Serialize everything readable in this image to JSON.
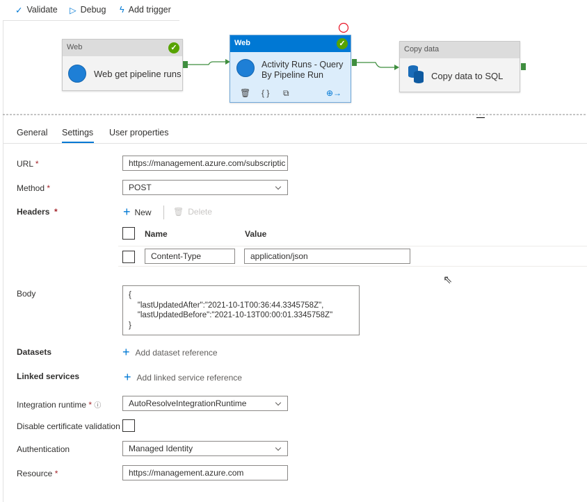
{
  "toolbar": {
    "validate": "Validate",
    "debug": "Debug",
    "add_trigger": "Add trigger"
  },
  "canvas": {
    "nodes": [
      {
        "type": "Web",
        "name": "Web get pipeline runs",
        "status": "succeeded"
      },
      {
        "type": "Web",
        "name_line1": "Activity Runs - Query",
        "name_line2": "By Pipeline Run",
        "status": "succeeded",
        "selected": true
      },
      {
        "type": "Copy data",
        "name": "Copy data to SQL"
      }
    ]
  },
  "tabs": [
    {
      "label": "General"
    },
    {
      "label": "Settings",
      "active": true
    },
    {
      "label": "User properties"
    }
  ],
  "form": {
    "url": {
      "label": "URL",
      "required": "*",
      "value": "https://management.azure.com/subscriptic"
    },
    "method": {
      "label": "Method",
      "required": "*",
      "value": "POST"
    },
    "headers": {
      "label": "Headers",
      "required": "*",
      "new": "New",
      "delete": "Delete",
      "col_name": "Name",
      "col_value": "Value",
      "rows": [
        {
          "name": "Content-Type",
          "value": "application/json"
        }
      ]
    },
    "body": {
      "label": "Body",
      "lines": [
        "{",
        "    \"lastUpdatedAfter\":\"2021-10-1T00:36:44.3345758Z\",",
        "    \"lastUpdatedBefore\":\"2021-10-13T00:00:01.3345758Z\"",
        "}"
      ]
    },
    "datasets": {
      "label": "Datasets",
      "add": "Add dataset reference"
    },
    "linked_services": {
      "label": "Linked services",
      "add": "Add linked service reference"
    },
    "integration_runtime": {
      "label": "Integration runtime",
      "required": "*",
      "value": "AutoResolveIntegrationRuntime"
    },
    "disable_cert": {
      "label": "Disable certificate validation",
      "checked": false
    },
    "authentication": {
      "label": "Authentication",
      "value": "Managed Identity"
    },
    "resource": {
      "label": "Resource",
      "required": "*",
      "value": "https://management.azure.com"
    }
  },
  "colors": {
    "accent": "#0078d4",
    "success": "#57a300",
    "connector": "#3f8e3f"
  }
}
